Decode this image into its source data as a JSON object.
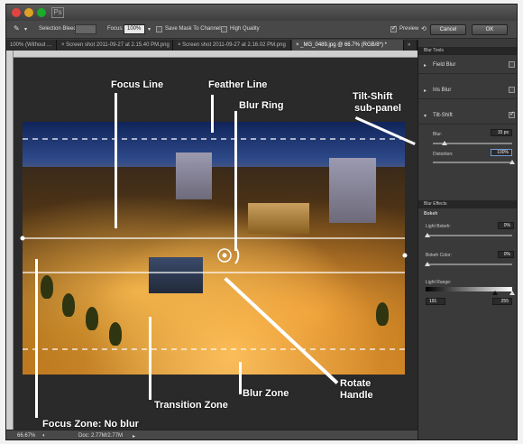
{
  "window": {
    "title": ""
  },
  "options_bar": {
    "selection_bleed_label": "Selection Bleed:",
    "focus_label": "Focus:",
    "focus_value": "100%",
    "save_mask_label": "Save Mask To Channels",
    "high_quality_label": "High Quality",
    "preview_label": "Preview",
    "cancel_label": "Cancel",
    "ok_label": "OK"
  },
  "tabs": [
    {
      "label": "100% (Without ..."
    },
    {
      "label": "Screen shot 2011-09-27 at 2.15.40 PM.png"
    },
    {
      "label": "Screen shot 2011-09-27 at 2.16.02 PM.png"
    },
    {
      "label": "_MG_0489.jpg @ 66.7% (RGB/8*) *"
    }
  ],
  "tab_overflow": "»",
  "panel": {
    "title": "Blur Tools",
    "tools": [
      {
        "label": "Field Blur",
        "checked": false
      },
      {
        "label": "Iris Blur",
        "checked": false
      },
      {
        "label": "Tilt-Shift",
        "checked": true
      }
    ],
    "blur_label": "Blur:",
    "blur_value": "15 px",
    "blur_level": 0.15,
    "distortion_label": "Distortion:",
    "distortion_value": "100%",
    "distortion_level": 1.0,
    "effects_title": "Blur Effects",
    "bokeh_label": "Bokeh",
    "light_bokeh_label": "Light Bokeh:",
    "light_bokeh_value": "0%",
    "bokeh_color_label": "Bokeh Color:",
    "bokeh_color_value": "0%",
    "light_range_label": "Light Range:",
    "light_range_min": "191",
    "light_range_max": "255"
  },
  "annotations": {
    "focus_line": "Focus Line",
    "feather_line": "Feather Line",
    "blur_ring": "Blur Ring",
    "tilt_shift_subpanel_1": "Tilt-Shift",
    "tilt_shift_subpanel_2": "sub-panel",
    "transition_zone": "Transition Zone",
    "blur_zone": "Blur Zone",
    "rotate_handle_1": "Rotate",
    "rotate_handle_2": "Handle",
    "focus_zone": "Focus Zone: No blur"
  },
  "status_bar": {
    "zoom": "66.67%",
    "doc": "Doc: 2.77M/2.77M"
  },
  "colors": {
    "panel_bg": "#3a3a3a",
    "accent": "#6d98d8"
  }
}
